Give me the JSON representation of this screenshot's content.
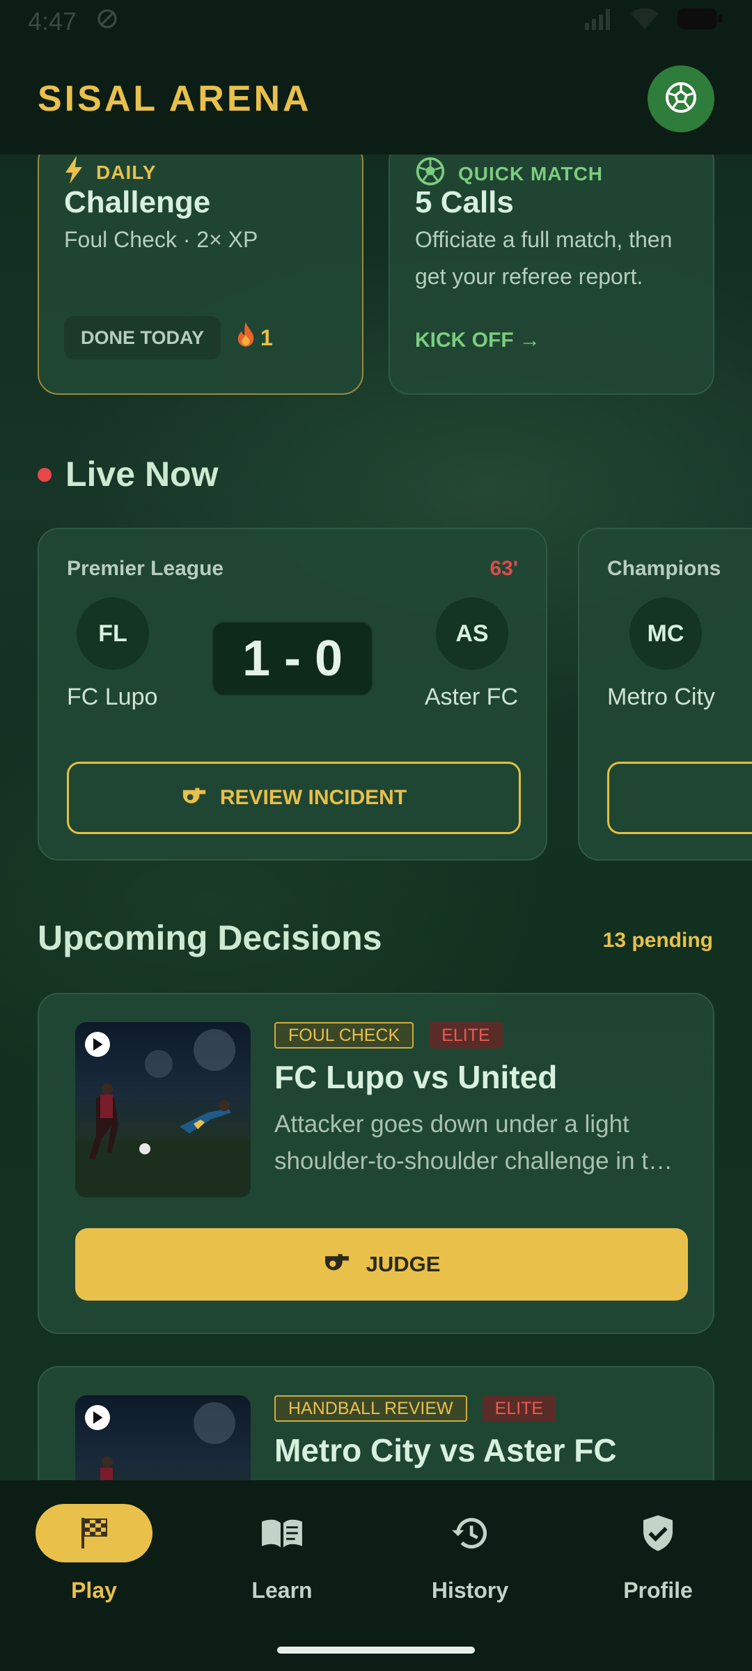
{
  "status_bar": {
    "time": "4:47"
  },
  "header": {
    "title": "SISAL ARENA",
    "action_icon": "soccer-ball-icon"
  },
  "promos": {
    "daily": {
      "tag": "DAILY",
      "title": "Challenge",
      "subtitle": "Foul Check · 2× XP",
      "status": "DONE TODAY",
      "streak": "1"
    },
    "quick": {
      "tag": "QUICK MATCH",
      "title": "5 Calls",
      "subtitle": "Officiate a full match, then get your referee report.",
      "cta": "KICK OFF →"
    }
  },
  "live": {
    "heading": "Live Now",
    "matches": [
      {
        "league": "Premier League",
        "minute": "63'",
        "home_abbr": "FL",
        "home": "FC Lupo",
        "away_abbr": "AS",
        "away": "Aster FC",
        "score": "1 - 0",
        "action": "REVIEW INCIDENT"
      },
      {
        "league": "Champions",
        "home_abbr": "MC",
        "home": "Metro City"
      }
    ]
  },
  "upcoming": {
    "heading": "Upcoming Decisions",
    "pending": "13 pending",
    "items": [
      {
        "category": "FOUL CHECK",
        "level": "ELITE",
        "title": "FC Lupo vs United",
        "description": "Attacker goes down under a light shoulder-to-shoulder challenge in t…",
        "action": "JUDGE"
      },
      {
        "category": "HANDBALL REVIEW",
        "level": "ELITE",
        "title": "Metro City vs Aster FC"
      }
    ]
  },
  "nav": {
    "items": [
      {
        "label": "Play",
        "icon": "checkered-flag-icon",
        "active": true
      },
      {
        "label": "Learn",
        "icon": "open-book-icon"
      },
      {
        "label": "History",
        "icon": "history-clock-icon"
      },
      {
        "label": "Profile",
        "icon": "shield-check-icon"
      }
    ]
  },
  "colors": {
    "accent": "#e9c04a",
    "live": "#e84848",
    "green": "#2f7d3a"
  }
}
